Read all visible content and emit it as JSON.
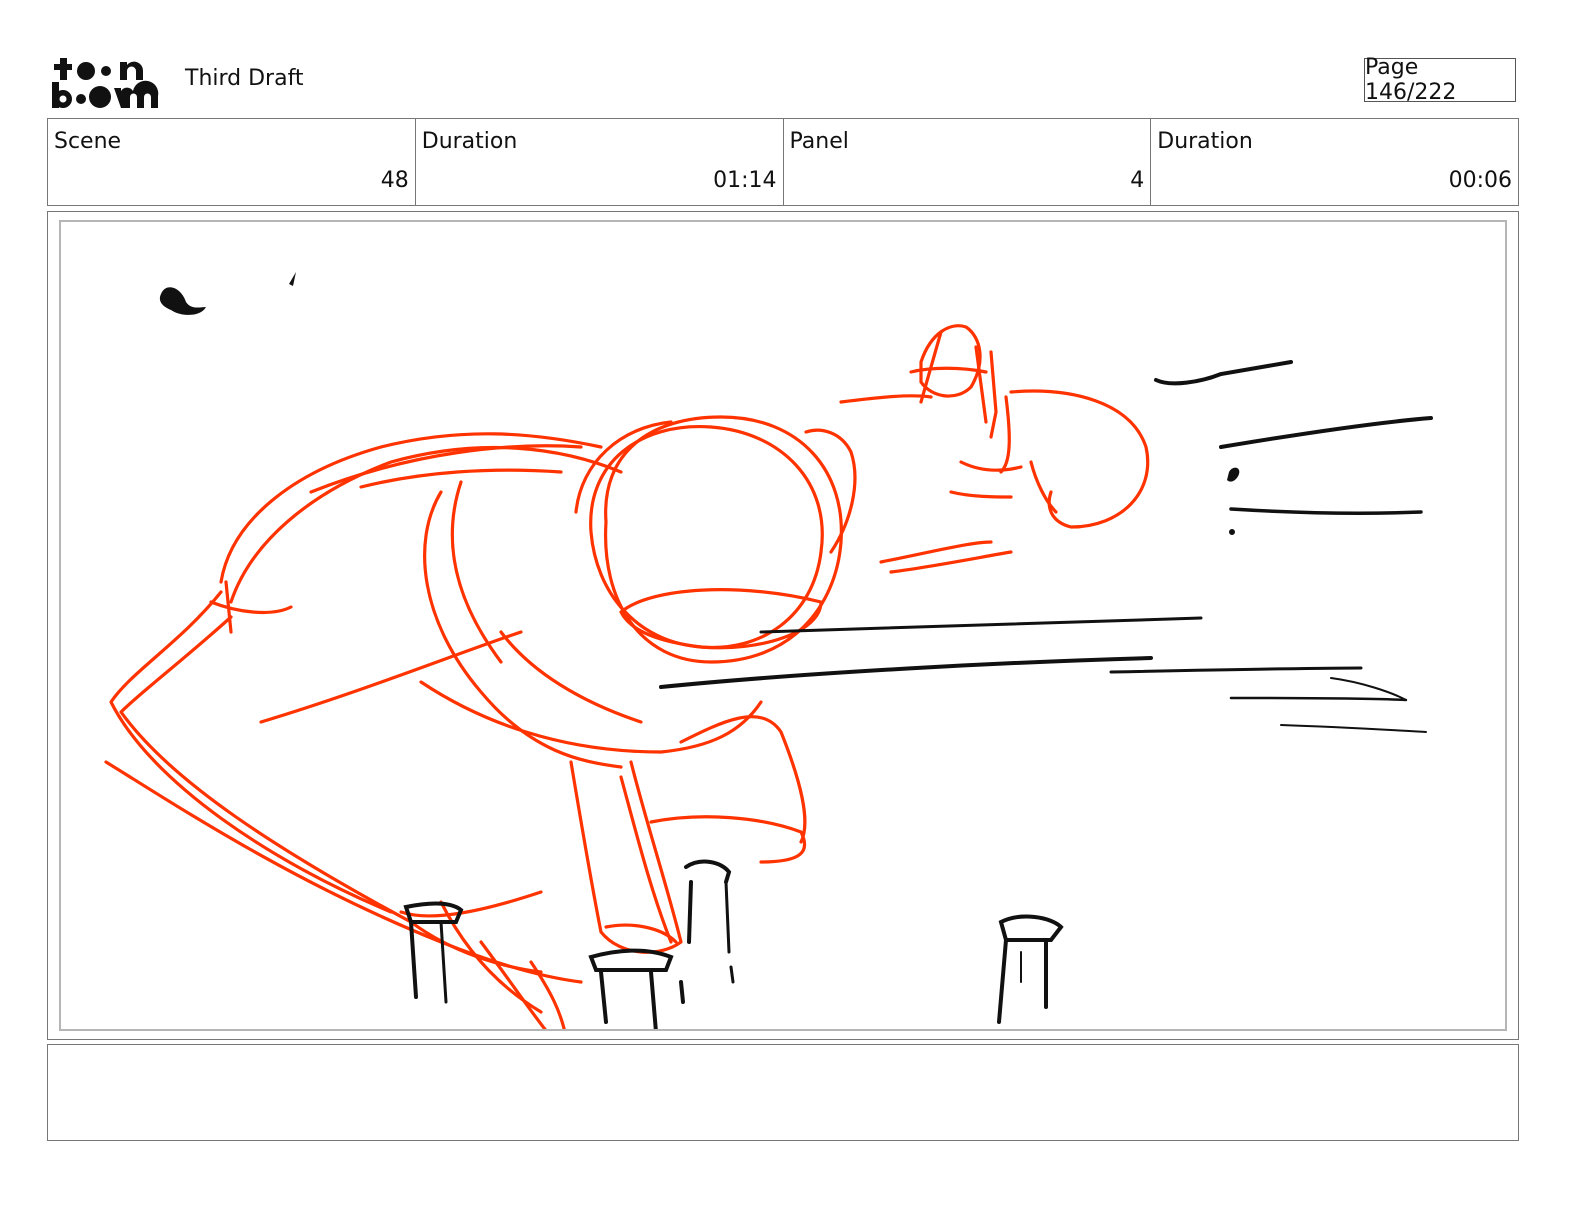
{
  "header": {
    "logo_text": "toon boom",
    "title": "Third Draft",
    "page_label": "Page 146/222"
  },
  "info": {
    "scene": {
      "label": "Scene",
      "value": "48"
    },
    "scene_duration": {
      "label": "Duration",
      "value": "01:14"
    },
    "panel": {
      "label": "Panel",
      "value": "4"
    },
    "panel_duration": {
      "label": "Duration",
      "value": "00:06"
    }
  },
  "sketch": {
    "rough_color": "#ff3300",
    "ink_color": "#111111"
  },
  "notes": {
    "text": ""
  }
}
